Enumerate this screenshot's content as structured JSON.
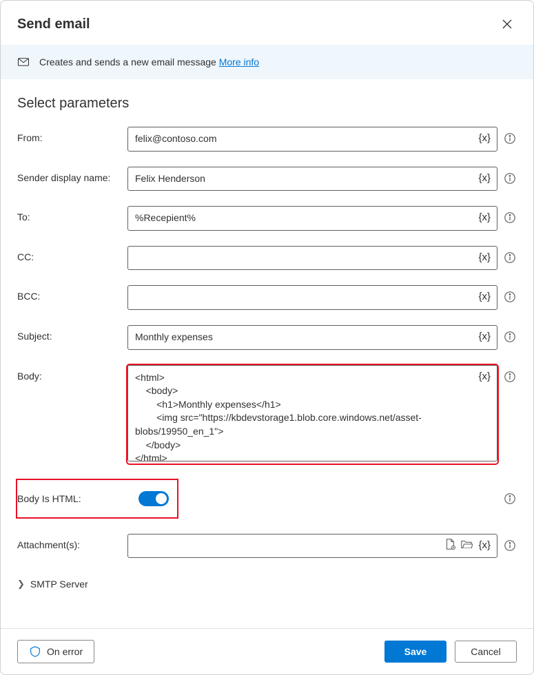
{
  "header": {
    "title": "Send email"
  },
  "banner": {
    "description": "Creates and sends a new email message ",
    "more_info": "More info"
  },
  "section_title": "Select parameters",
  "fields": {
    "from": {
      "label": "From:",
      "value": "felix@contoso.com"
    },
    "sender": {
      "label": "Sender display name:",
      "value": "Felix Henderson"
    },
    "to": {
      "label": "To:",
      "value": "%Recepient%"
    },
    "cc": {
      "label": "CC:",
      "value": ""
    },
    "bcc": {
      "label": "BCC:",
      "value": ""
    },
    "subject": {
      "label": "Subject:",
      "value": "Monthly expenses"
    },
    "body": {
      "label": "Body:",
      "value": "<html>\n    <body>\n        <h1>Monthly expenses</h1>\n        <img src=\"https://kbdevstorage1.blob.core.windows.net/asset-blobs/19950_en_1\">\n    </body>\n</html>"
    },
    "body_is_html": {
      "label": "Body Is HTML:",
      "value": true
    },
    "attachments": {
      "label": "Attachment(s):",
      "value": ""
    }
  },
  "expander": {
    "label": "SMTP Server"
  },
  "footer": {
    "on_error": "On error",
    "save": "Save",
    "cancel": "Cancel"
  },
  "icons": {
    "variable": "{x}"
  }
}
